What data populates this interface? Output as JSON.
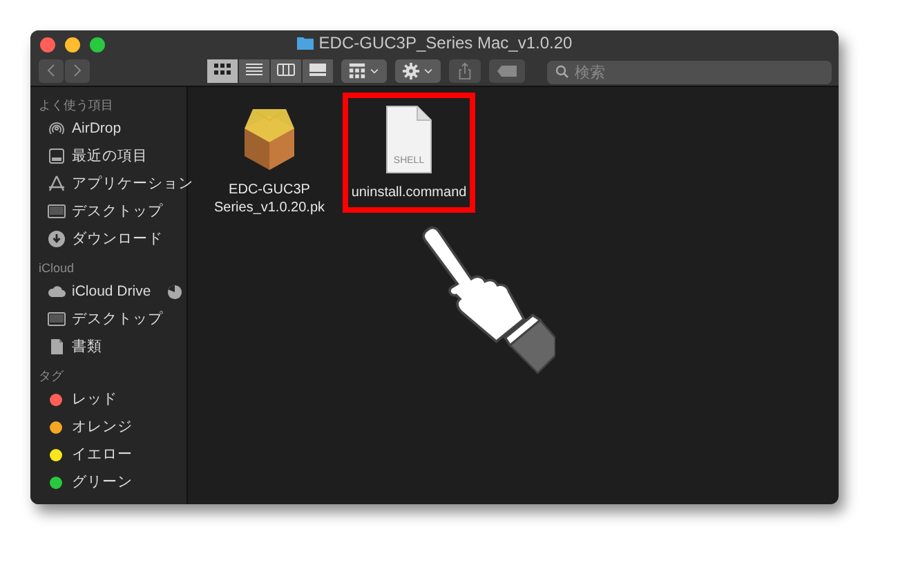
{
  "window": {
    "title": "EDC-GUC3P_Series Mac_v1.0.20"
  },
  "toolbar": {
    "view_modes": [
      {
        "kind": "icons",
        "selected": true
      },
      {
        "kind": "list",
        "selected": false
      },
      {
        "kind": "columns",
        "selected": false
      },
      {
        "kind": "gallery",
        "selected": false
      }
    ],
    "search": {
      "placeholder": "検索"
    }
  },
  "sidebar": {
    "sections": [
      {
        "title": "よく使う項目",
        "items": [
          {
            "kind": "airdrop",
            "label": "AirDrop"
          },
          {
            "kind": "recents",
            "label": "最近の項目"
          },
          {
            "kind": "apps",
            "label": "アプリケーション"
          },
          {
            "kind": "desktop",
            "label": "デスクトップ"
          },
          {
            "kind": "downloads",
            "label": "ダウンロード"
          }
        ]
      },
      {
        "title": "iCloud",
        "items": [
          {
            "kind": "cloud",
            "label": "iCloud Drive"
          },
          {
            "kind": "desktop",
            "label": "デスクトップ"
          },
          {
            "kind": "documents",
            "label": "書類"
          }
        ]
      },
      {
        "title": "タグ",
        "items": [
          {
            "kind": "tag",
            "label": "レッド",
            "color": "#ff5f57"
          },
          {
            "kind": "tag",
            "label": "オレンジ",
            "color": "#f5a623"
          },
          {
            "kind": "tag",
            "label": "イエロー",
            "color": "#f8e71c"
          },
          {
            "kind": "tag",
            "label": "グリーン",
            "color": "#28c940"
          }
        ]
      }
    ]
  },
  "files": [
    {
      "kind": "package",
      "name": "EDC-GUC3P Series_v1.0.20.pk",
      "highlighted": false
    },
    {
      "kind": "shell",
      "name": "uninstall.command",
      "badge": "SHELL",
      "highlighted": true
    }
  ]
}
